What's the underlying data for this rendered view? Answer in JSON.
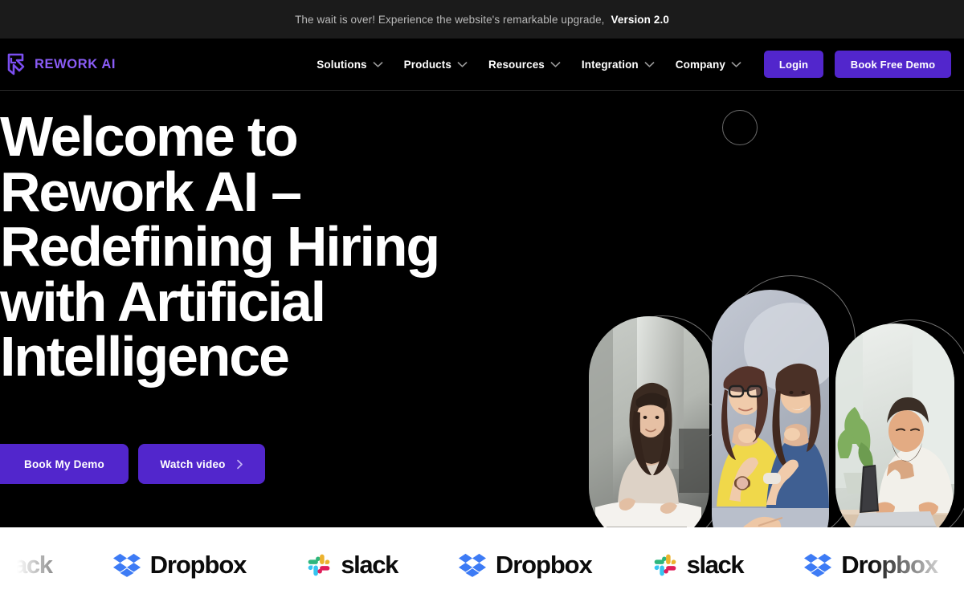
{
  "announcement": {
    "text": "The wait is over! Experience the website's remarkable upgrade,",
    "version": "Version 2.0"
  },
  "brand": {
    "name": "REWORK AI",
    "logo_icon": "rework-logo-mark",
    "color": "#8a5cf6"
  },
  "nav": {
    "items": [
      {
        "label": "Solutions",
        "icon": "chevron-down-icon"
      },
      {
        "label": "Products",
        "icon": "chevron-down-icon"
      },
      {
        "label": "Resources",
        "icon": "chevron-down-icon"
      },
      {
        "label": "Integration",
        "icon": "chevron-down-icon"
      },
      {
        "label": "Company",
        "icon": "chevron-down-icon"
      }
    ],
    "login_label": "Login",
    "demo_label": "Book Free Demo",
    "accent_color": "#5226cc"
  },
  "hero": {
    "title": "Welcome to\nRework AI –\nRedefining Hiring\nwith Artificial\nIntelligence",
    "primary_cta": "Book My Demo",
    "secondary_cta": "Watch video",
    "secondary_cta_icon": "chevron-right-icon",
    "background_color": "#000000",
    "media": [
      {
        "name": "woman-at-desk-photo"
      },
      {
        "name": "two-women-with-laptop-photo"
      },
      {
        "name": "man-typing-on-laptop-photo"
      }
    ]
  },
  "logo_strip": {
    "background_color": "#ffffff",
    "logos": [
      {
        "name": "slack",
        "label": "slack",
        "icon": "slack-icon",
        "faded": true
      },
      {
        "name": "dropbox",
        "label": "Dropbox",
        "icon": "dropbox-icon",
        "faded": false
      },
      {
        "name": "slack",
        "label": "slack",
        "icon": "slack-icon",
        "faded": false
      },
      {
        "name": "dropbox",
        "label": "Dropbox",
        "icon": "dropbox-icon",
        "faded": false
      },
      {
        "name": "slack",
        "label": "slack",
        "icon": "slack-icon",
        "faded": false
      },
      {
        "name": "dropbox",
        "label": "Dropbox",
        "icon": "dropbox-icon",
        "faded": true
      }
    ]
  }
}
